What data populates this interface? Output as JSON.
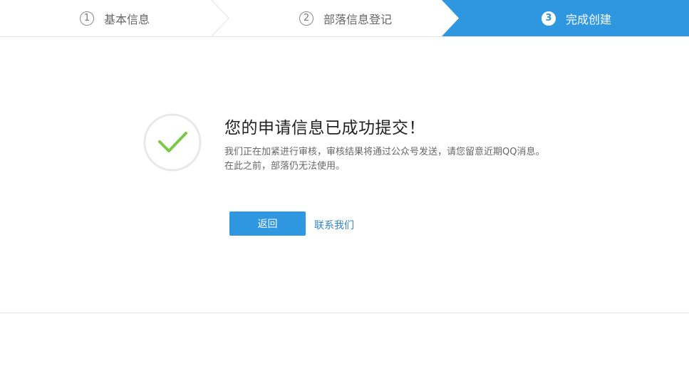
{
  "steps": [
    {
      "number": "1",
      "label": "基本信息",
      "state": "done"
    },
    {
      "number": "2",
      "label": "部落信息登记",
      "state": "done"
    },
    {
      "number": "3",
      "label": "完成创建",
      "state": "active"
    }
  ],
  "colors": {
    "accent": "#2f96e0",
    "success": "#7ac943",
    "link": "#2f86c8"
  },
  "result": {
    "icon": "checkmark-circle-icon",
    "title": "您的申请信息已成功提交！",
    "description_line1": "我们正在加紧进行审核，审核结果将通过公众号发送，请您留意近期QQ消息。",
    "description_line2": "在此之前，部落仍无法使用。"
  },
  "actions": {
    "back_label": "返回",
    "contact_label": "联系我们"
  }
}
